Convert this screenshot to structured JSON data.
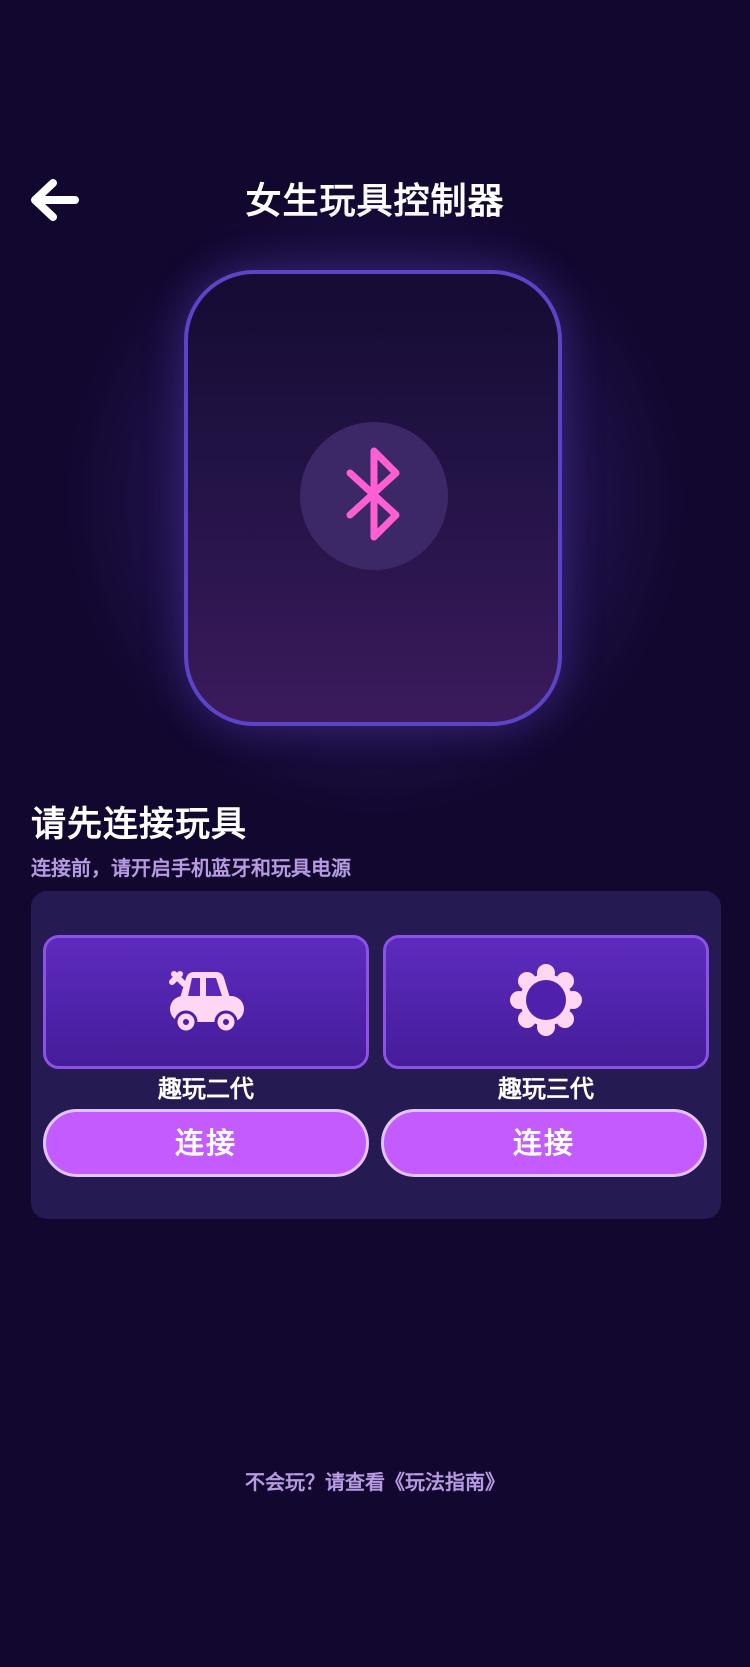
{
  "header": {
    "title": "女生玩具控制器",
    "back_icon": "arrow-left-icon"
  },
  "device_card": {
    "icon": "bluetooth-icon",
    "icon_color": "#ff5fd2"
  },
  "connect_section": {
    "title": "请先连接玩具",
    "subtitle": "连接前，请开启手机蓝牙和玩具电源",
    "toys": [
      {
        "name": "趣玩二代",
        "icon": "car-icon",
        "button_label": "连接"
      },
      {
        "name": "趣玩三代",
        "icon": "flower-icon",
        "button_label": "连接"
      }
    ]
  },
  "footer": {
    "guide_link": "不会玩？请查看《玩法指南》"
  },
  "colors": {
    "background": "#12072f",
    "accent": "#c45bff",
    "bluetooth": "#ff5fd2",
    "icon_pink": "#ffd6f3",
    "card_border": "#5c44c7"
  }
}
